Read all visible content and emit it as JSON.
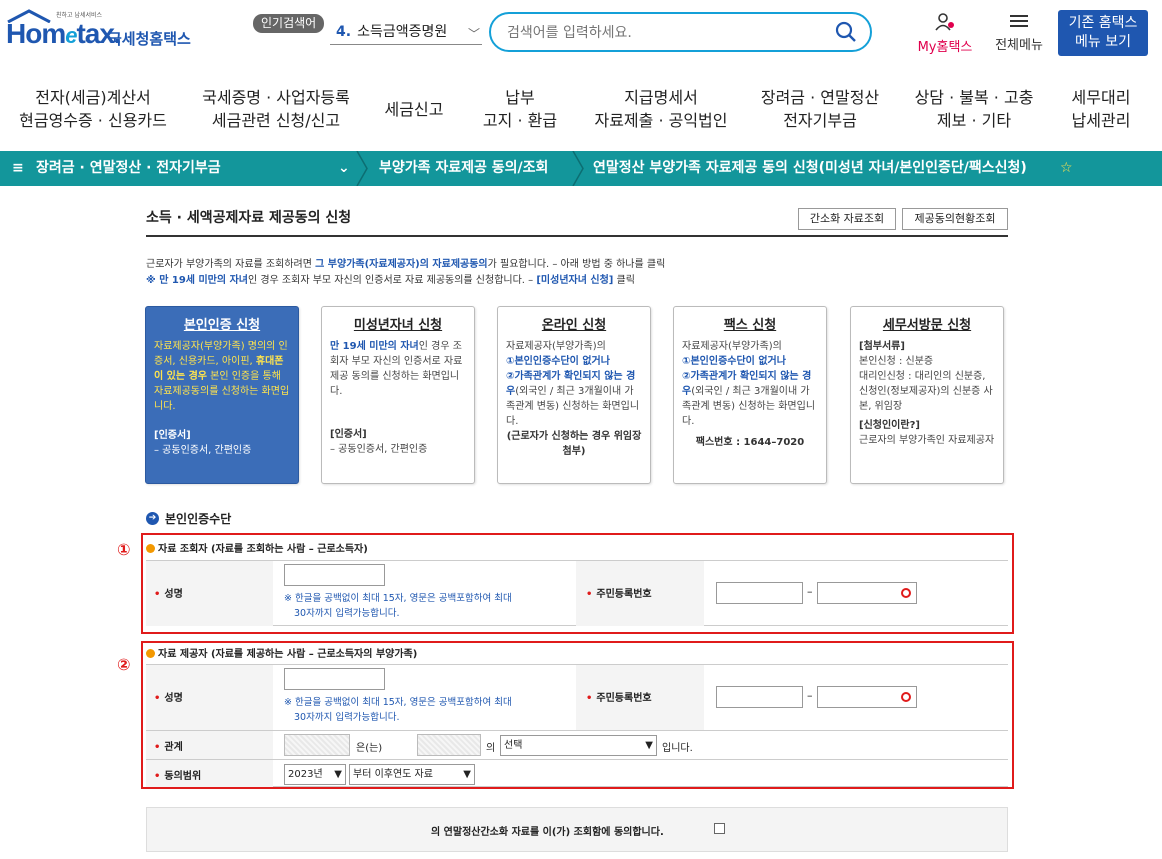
{
  "header": {
    "logo_sub": "친하고 납세서비스",
    "logo_main": "Hom",
    "logo_e": "e",
    "logo_tail": "tax.",
    "logo_kr": "국세청홈택스",
    "popular_badge": "인기검색어",
    "popular_rank": "4.",
    "popular_term": "소득금액증명원",
    "search_placeholder": "검색어를 입력하세요.",
    "my_hometax": "My홈택스",
    "all_menu": "전체메뉴",
    "old_line1": "기존 홈택스",
    "old_line2": "메뉴 보기"
  },
  "nav": [
    {
      "l1": "전자(세금)계산서",
      "l2": "현금영수증 · 신용카드"
    },
    {
      "l1": "국세증명 · 사업자등록",
      "l2": "세금관련 신청/신고"
    },
    {
      "l1": "세금신고",
      "l2": ""
    },
    {
      "l1": "납부",
      "l2": "고지 · 환급"
    },
    {
      "l1": "지급명세서",
      "l2": "자료제출 · 공익법인"
    },
    {
      "l1": "장려금 · 연말정산",
      "l2": "전자기부금"
    },
    {
      "l1": "상담 · 불복 · 고충",
      "l2": "제보 · 기타"
    },
    {
      "l1": "세무대리",
      "l2": "납세관리"
    }
  ],
  "breadcrumb": {
    "menu": "≡",
    "item1": "장려금 · 연말정산 · 전자기부금",
    "item2": "부양가족 자료제공 동의/조회",
    "item3": "연말정산 부양가족 자료제공 동의 신청(미성년 자녀/본인인증단/팩스신청)",
    "star": "☆"
  },
  "page": {
    "title": "소득 · 세액공제자료 제공동의 신청",
    "btn_simple": "간소화 자료조회",
    "btn_status": "제공동의현황조회",
    "intro1_a": "근로자가 부양가족의 자료를 조회하려면 ",
    "intro1_b": "그 부양가족(자료제공자)의 자료제공동의",
    "intro1_c": "가 필요합니다. – 아래 방법 중 하나를 클릭",
    "intro2_a": "※ 만 19세 미만의 자녀",
    "intro2_b": "인 경우 조회자 부모 자신의 인증서로 자료 제공동의를 신청합니다. – ",
    "intro2_c": "[미성년자녀 신청]",
    "intro2_d": " 클릭"
  },
  "cards": {
    "c1": {
      "title": "본인인증 신청",
      "t1": "자료제공자(부양가족) 명의의 인증서, 신용카드, 아이핀, ",
      "t2": "휴대폰이 있는 경우",
      "t3": " 본인 인증을 통해 자료제공동의를 신청하는 화면입니다.",
      "h": "[인증서]",
      "f": "– 공동인증서, 간편인증"
    },
    "c2": {
      "title": "미성년자녀 신청",
      "b": "만 19세 미만의 자녀",
      "t": "인 경우 조회자 부모 자신의 인증서로 자료 제공 동의를 신청하는 화면입니다.",
      "h": "[인증서]",
      "f": "– 공동인증서, 간편인증"
    },
    "c3": {
      "title": "온라인 신청",
      "t1": "자료제공자(부양가족)의",
      "b1": "①본인인증수단이 없거나",
      "b2": "②가족관계가 확인되지 않는 경우",
      "t2": "(외국인 / 최근 3개월이내 가족관계 변동) 신청하는 화면입니다.",
      "f": "(근로자가 신청하는 경우 위임장 첨부)"
    },
    "c4": {
      "title": "팩스 신청",
      "t1": "자료제공자(부양가족)의",
      "b1": "①본인인증수단이 없거나",
      "b2": "②가족관계가 확인되지 않는 경우",
      "t2": "(외국인 / 최근 3개월이내 가족관계 변동) 신청하는 화면입니다.",
      "f": "팩스번호 : 1644–7020"
    },
    "c5": {
      "title": "세무서방문 신청",
      "h1": "[첨부서류]",
      "t1": "본인신청 : 신분증",
      "t2": "대리인신청 : 대리인의 신분증, 신청인(정보제공자)의 신분증 사본, 위임장",
      "h2": "[신청인이란?]",
      "t3": "근로자의 부양가족인 자료제공자"
    }
  },
  "method": {
    "icon": "➔",
    "title": "본인인증수단"
  },
  "section1": {
    "num": "①",
    "head": "자료 조회자 (자료를 조회하는 사람 – 근로소득자)",
    "name_label": "성명",
    "name_value": "",
    "note1": "※ 한글을 공백없이 최대 15자, 영문은 공백포함하여 최대",
    "note2": "30자까지 입력가능합니다.",
    "rrn_label": "주민등록번호",
    "dash": "–"
  },
  "section2": {
    "num": "②",
    "head": "자료 제공자 (자료를 제공하는 사람 – 근로소득자의 부양가족)",
    "name_label": "성명",
    "note1": "※ 한글을 공백없이 최대 15자, 영문은 공백포함하여 최대",
    "note2": "30자까지 입력가능합니다.",
    "rrn_label": "주민등록번호",
    "dash": "–",
    "rel_label": "관계",
    "rel_eun": "은(는)",
    "rel_ui": "의",
    "rel_select": "선택",
    "rel_tail": "입니다.",
    "scope_label": "동의범위",
    "year_select": "2023년",
    "scope_select": "부터 이후연도 자료"
  },
  "consent": {
    "text": "의 연말정산간소화 자료를 이(가) 조회함에 동의합니다."
  }
}
